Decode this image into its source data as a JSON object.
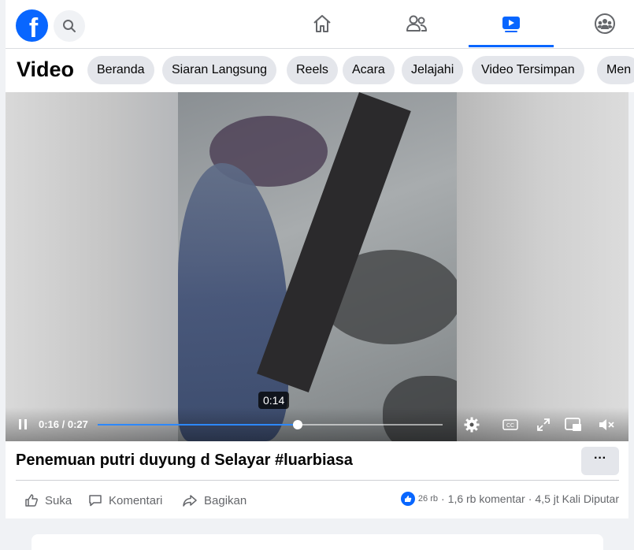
{
  "topbar": {
    "logo_letter": "f",
    "nav": [
      {
        "name": "home",
        "icon": "home-icon",
        "active": false
      },
      {
        "name": "friends",
        "icon": "friends-icon",
        "active": false
      },
      {
        "name": "video",
        "icon": "video-icon",
        "active": true
      },
      {
        "name": "groups",
        "icon": "groups-icon",
        "active": false
      }
    ],
    "accent_color": "#0866ff"
  },
  "videobar": {
    "title": "Video",
    "pills": [
      "Beranda",
      "Siaran Langsung",
      "Reels",
      "Acara",
      "Jelajahi",
      "Video Tersimpan",
      "Men"
    ]
  },
  "player": {
    "current_time": "0:16",
    "duration": "0:27",
    "time_display": "0:16 / 0:27",
    "hover_tooltip": "0:14",
    "progress_fraction": 0.58
  },
  "post": {
    "title": "Penemuan putri duyung d Selayar #luarbiasa",
    "more_label": "···",
    "actions": {
      "like": "Suka",
      "comment": "Komentari",
      "share": "Bagikan"
    },
    "stats": {
      "reactions": "26 rb",
      "separator": "·",
      "comments": "1,6 rb komentar",
      "views": "4,5 jt Kali Diputar"
    }
  }
}
